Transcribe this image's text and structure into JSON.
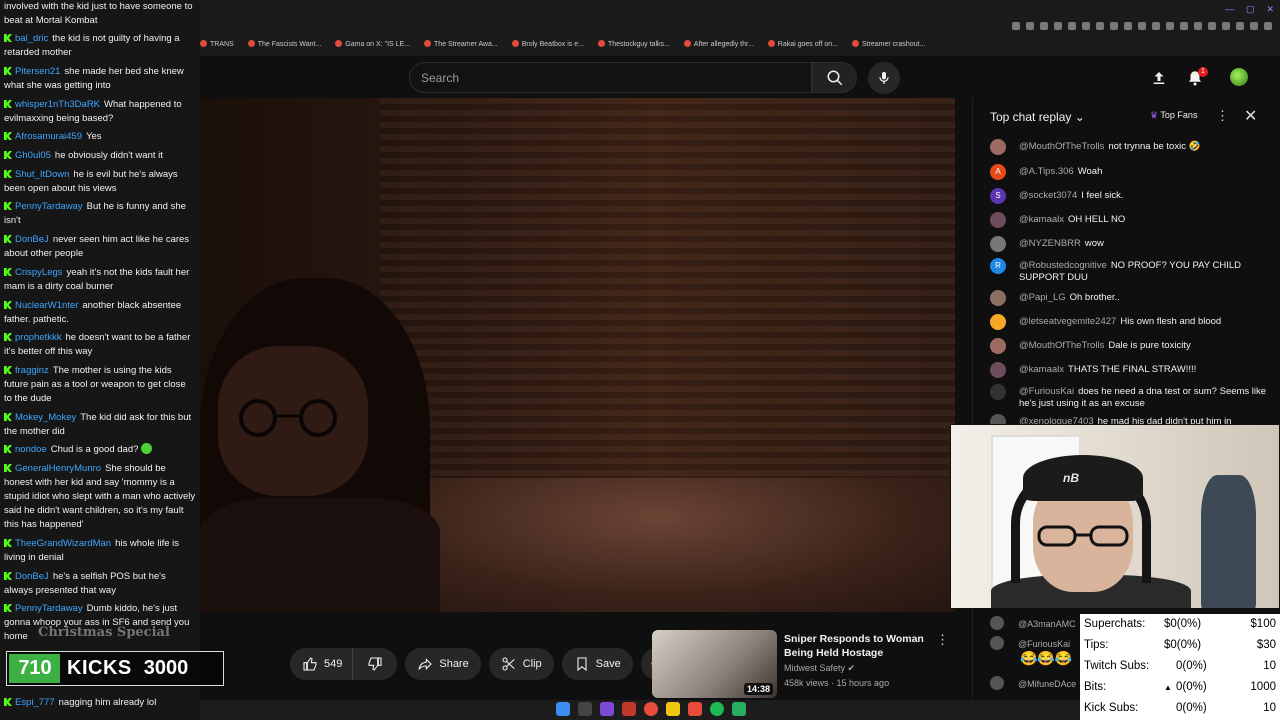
{
  "browser": {
    "bookmarks": [
      "TRANS",
      "The Fascists Want...",
      "Gama on X: \"IS LE...",
      "The Streamer Awa...",
      "Broly Beatbox is e...",
      "Thestockguy talks...",
      "After allegedly thr...",
      "Rakai goes off on...",
      "Streamer crashout..."
    ]
  },
  "header": {
    "search_placeholder": "Search",
    "notification_count": "1"
  },
  "stream_chat": {
    "messages": [
      {
        "user": "",
        "text": "involved with the kid just to have someone to beat at Mortal Kombat"
      },
      {
        "user": "bal_dric",
        "text": "the kid is not guilty of having a retarded mother"
      },
      {
        "user": "Pitersen21",
        "text": "she made her bed she knew what she was getting into"
      },
      {
        "user": "whisper1nTh3DaRK",
        "text": "What happened to evilmaxxing being based?"
      },
      {
        "user": "Afrosamurai459",
        "text": "Yes"
      },
      {
        "user": "Gh0ul05",
        "text": "he obviously didn't want it"
      },
      {
        "user": "Shut_ItDown",
        "text": "he is evil but he's always been open about his views"
      },
      {
        "user": "PennyTardaway",
        "text": "But he is funny and she isn't"
      },
      {
        "user": "DonBeJ",
        "text": "never seen him act like he cares about other people"
      },
      {
        "user": "CrispyLegs",
        "text": "yeah it's not the kids fault her mam is a dirty coal burner"
      },
      {
        "user": "NuclearW1nter",
        "text": "another black absentee father. pathetic."
      },
      {
        "user": "prophetkkk",
        "text": "he doesn't want to be a father it's better off this way"
      },
      {
        "user": "fragginz",
        "text": "The mother is using the kids future pain as a tool or weapon to get close to the dude"
      },
      {
        "user": "Mokey_Mokey",
        "text": "The kid did ask for this but the mother did"
      },
      {
        "user": "nondoe",
        "text": "Chud is a good dad?"
      },
      {
        "user": "GeneralHenryMunro",
        "text": "She should be honest with her kid and say 'mommy is a stupid idiot who slept with a man who actively said he didn't want children, so it's my fault this has happened'"
      },
      {
        "user": "TheeGrandWizardMan",
        "text": "his whole life is living in denial"
      },
      {
        "user": "DonBeJ",
        "text": "he's a selfish POS but he's always presented that way"
      },
      {
        "user": "PennyTardaway",
        "text": "Dumb kiddo, he's just gonna whoop your ass in SF6 and send you home"
      },
      {
        "user": "Espi_777",
        "text": "nagging him already lol"
      }
    ],
    "overlay_text": "Christmas Special",
    "kick_goal": {
      "current": "710",
      "label": "KICKS",
      "target": "3000",
      "progress": 0.237
    }
  },
  "actions": {
    "like_count": "549",
    "share_label": "Share",
    "clip_label": "Clip",
    "save_label": "Save"
  },
  "recommended": {
    "title": "Sniper Responds to Woman Being Held Hostage",
    "channel": "Midwest Safety",
    "views": "458k views",
    "age": "15 hours ago",
    "duration": "14:38"
  },
  "live_chat": {
    "title": "Top chat replay",
    "top_fans_label": "Top Fans",
    "messages": [
      {
        "author": "@MouthOfTheTrolls",
        "text": "not trynna be toxic 🤣",
        "avatar_color": "#9e6b63",
        "avatar_letter": ""
      },
      {
        "author": "@A.Tips.306",
        "text": "Woah",
        "avatar_color": "#e64a19",
        "avatar_letter": "A"
      },
      {
        "author": "@socket3074",
        "text": "I feel sick.",
        "avatar_color": "#5e35b1",
        "avatar_letter": "S"
      },
      {
        "author": "@kamaalx",
        "text": "OH HELL NO",
        "avatar_color": "#6d4c5b",
        "avatar_letter": ""
      },
      {
        "author": "@NYZENBRR",
        "text": "wow",
        "avatar_color": "#777777",
        "avatar_letter": ""
      },
      {
        "author": "@Robustedcognitive",
        "text": "NO PROOF? YOU PAY CHILD SUPPORT DUU",
        "avatar_color": "#1e88e5",
        "avatar_letter": "R"
      },
      {
        "author": "@Papi_LG",
        "text": "Oh brother..",
        "avatar_color": "#8d6e63",
        "avatar_letter": ""
      },
      {
        "author": "@letseatvegemite2427",
        "text": "His own flesh and blood",
        "avatar_color": "#f9a825",
        "avatar_letter": ""
      },
      {
        "author": "@MouthOfTheTrolls",
        "text": "Dale is pure toxicity",
        "avatar_color": "#9e6b63",
        "avatar_letter": ""
      },
      {
        "author": "@kamaalx",
        "text": "THATS THE FINAL STRAW!!!!",
        "avatar_color": "#6d4c5b",
        "avatar_letter": ""
      },
      {
        "author": "@FuriousKai",
        "text": "does he need a dna test or sum? Seems like he's just using it as an excuse",
        "avatar_color": "#333333",
        "avatar_letter": ""
      },
      {
        "author": "@xenologue7403",
        "text": "he mad his dad didn't put him in",
        "avatar_color": "#555555",
        "avatar_letter": ""
      }
    ],
    "lower": [
      {
        "author": "@A3manAMC",
        "text": ""
      },
      {
        "author": "@FuriousKai",
        "text": ""
      },
      {
        "author": "@MifuneDAce",
        "text": ""
      }
    ]
  },
  "goals": {
    "rows": [
      {
        "label": "Superchats:",
        "value": "$0(0%)",
        "target": "$100"
      },
      {
        "label": "Tips:",
        "value": "$0(0%)",
        "target": "$30"
      },
      {
        "label": "Twitch Subs:",
        "value": "0(0%)",
        "target": "10"
      },
      {
        "label": "Bits:",
        "value": "0(0%)",
        "target": "1000"
      },
      {
        "label": "Kick Subs:",
        "value": "0(0%)",
        "target": "10"
      }
    ]
  },
  "colors": {
    "kick_green": "#53fc18",
    "youtube_red": "#e31c23",
    "background": "#0f0f0f"
  }
}
